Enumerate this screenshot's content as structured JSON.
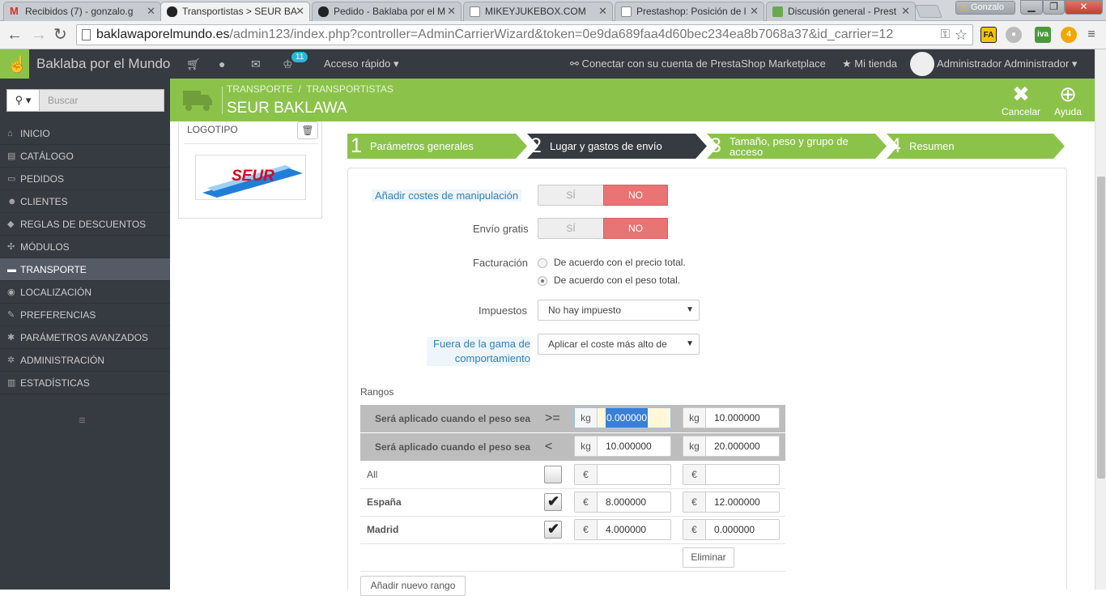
{
  "browser": {
    "tabs": [
      {
        "label": "Recibidos (7) - gonzalo.g",
        "icon": "gmail-icon"
      },
      {
        "label": "Transportistas > SEUR BA",
        "icon": "prestashop-icon"
      },
      {
        "label": "Pedido - Baklaba por el M",
        "icon": "prestashop-icon"
      },
      {
        "label": "MIKEYJUKEBOX.COM",
        "icon": "page-icon"
      },
      {
        "label": "Prestashop: Posición de l",
        "icon": "page-icon"
      },
      {
        "label": "Discusión general - Prest",
        "icon": "forum-icon"
      }
    ],
    "user": "Gonzalo",
    "url_host": "baklawaporelmundo.es",
    "url_path": "/admin123/index.php?controller=AdminCarrierWizard&token=0e9da689faa4d60bec234ea8b7068a37&id_carrier=12"
  },
  "topnav": {
    "shop_name": "Baklaba por el Mundo",
    "notification_count": "11",
    "quick_access": "Acceso rápido",
    "connect": "Conectar con su cuenta de PrestaShop Marketplace",
    "my_store": "Mi tienda",
    "admin_name": "Administrador Administrador"
  },
  "sidebar": {
    "search_placeholder": "Buscar",
    "items": [
      {
        "label": "Inicio",
        "icon": "home-icon"
      },
      {
        "label": "Catálogo",
        "icon": "book-icon"
      },
      {
        "label": "Pedidos",
        "icon": "credit-card-icon"
      },
      {
        "label": "Clientes",
        "icon": "users-icon"
      },
      {
        "label": "Reglas de descuentos",
        "icon": "tag-icon"
      },
      {
        "label": "Módulos",
        "icon": "puzzle-icon"
      },
      {
        "label": "Transporte",
        "icon": "truck-icon",
        "active": true
      },
      {
        "label": "Localización",
        "icon": "globe-icon"
      },
      {
        "label": "Preferencias",
        "icon": "wrench-icon"
      },
      {
        "label": "Parámetros avanzados",
        "icon": "cogs-icon"
      },
      {
        "label": "Administración",
        "icon": "cog-icon"
      },
      {
        "label": "Estadísticas",
        "icon": "bar-chart-icon"
      }
    ]
  },
  "toolbar": {
    "breadcrumb_1": "Transporte",
    "breadcrumb_sep": "/",
    "breadcrumb_2": "Transportistas",
    "title": "SEUR BAKLAWA",
    "cancel": "Cancelar",
    "help": "Ayuda"
  },
  "logo_panel": {
    "label": "Logotipo",
    "brand": "SEUR"
  },
  "steps": [
    {
      "num": "1",
      "label": "Parámetros generales",
      "state": "done"
    },
    {
      "num": "2",
      "label": "Lugar y gastos de envío",
      "state": "current"
    },
    {
      "num": "3",
      "label": "Tamaño, peso y grupo de acceso",
      "state": "todo"
    },
    {
      "num": "4",
      "label": "Resumen",
      "state": "todo"
    }
  ],
  "form": {
    "handling_label": "Añadir costes de manipulación",
    "free_label": "Envío gratis",
    "yes": "Sí",
    "no": "NO",
    "billing_label": "Facturación",
    "billing_price": "De acuerdo con el precio total.",
    "billing_weight": "De acuerdo con el peso total.",
    "billing_selected": "weight",
    "tax_label": "Impuestos",
    "tax_value": "No hay impuesto",
    "oor_label_1": "Fuera de la gama de",
    "oor_label_2": "comportamiento",
    "oor_value": "Aplicar el coste más alto de"
  },
  "ranges": {
    "title": "Rangos",
    "row1_label": "Será aplicado cuando el peso sea",
    "row1_op": ">=",
    "row2_label": "Será aplicado cuando el peso sea",
    "row2_op": "<",
    "unit": "kg",
    "currency": "€",
    "from": [
      "0.000000",
      "10.000000"
    ],
    "to": [
      "10.000000",
      "20.000000"
    ],
    "zones": [
      {
        "name": "All",
        "checked": false,
        "prices": [
          "",
          ""
        ]
      },
      {
        "name": "España",
        "checked": true,
        "prices": [
          "8.000000",
          "12.000000"
        ]
      },
      {
        "name": "Madrid",
        "checked": true,
        "prices": [
          "4.000000",
          "0.000000"
        ]
      }
    ],
    "delete": "Eliminar",
    "add": "Añadir nuevo rango"
  }
}
